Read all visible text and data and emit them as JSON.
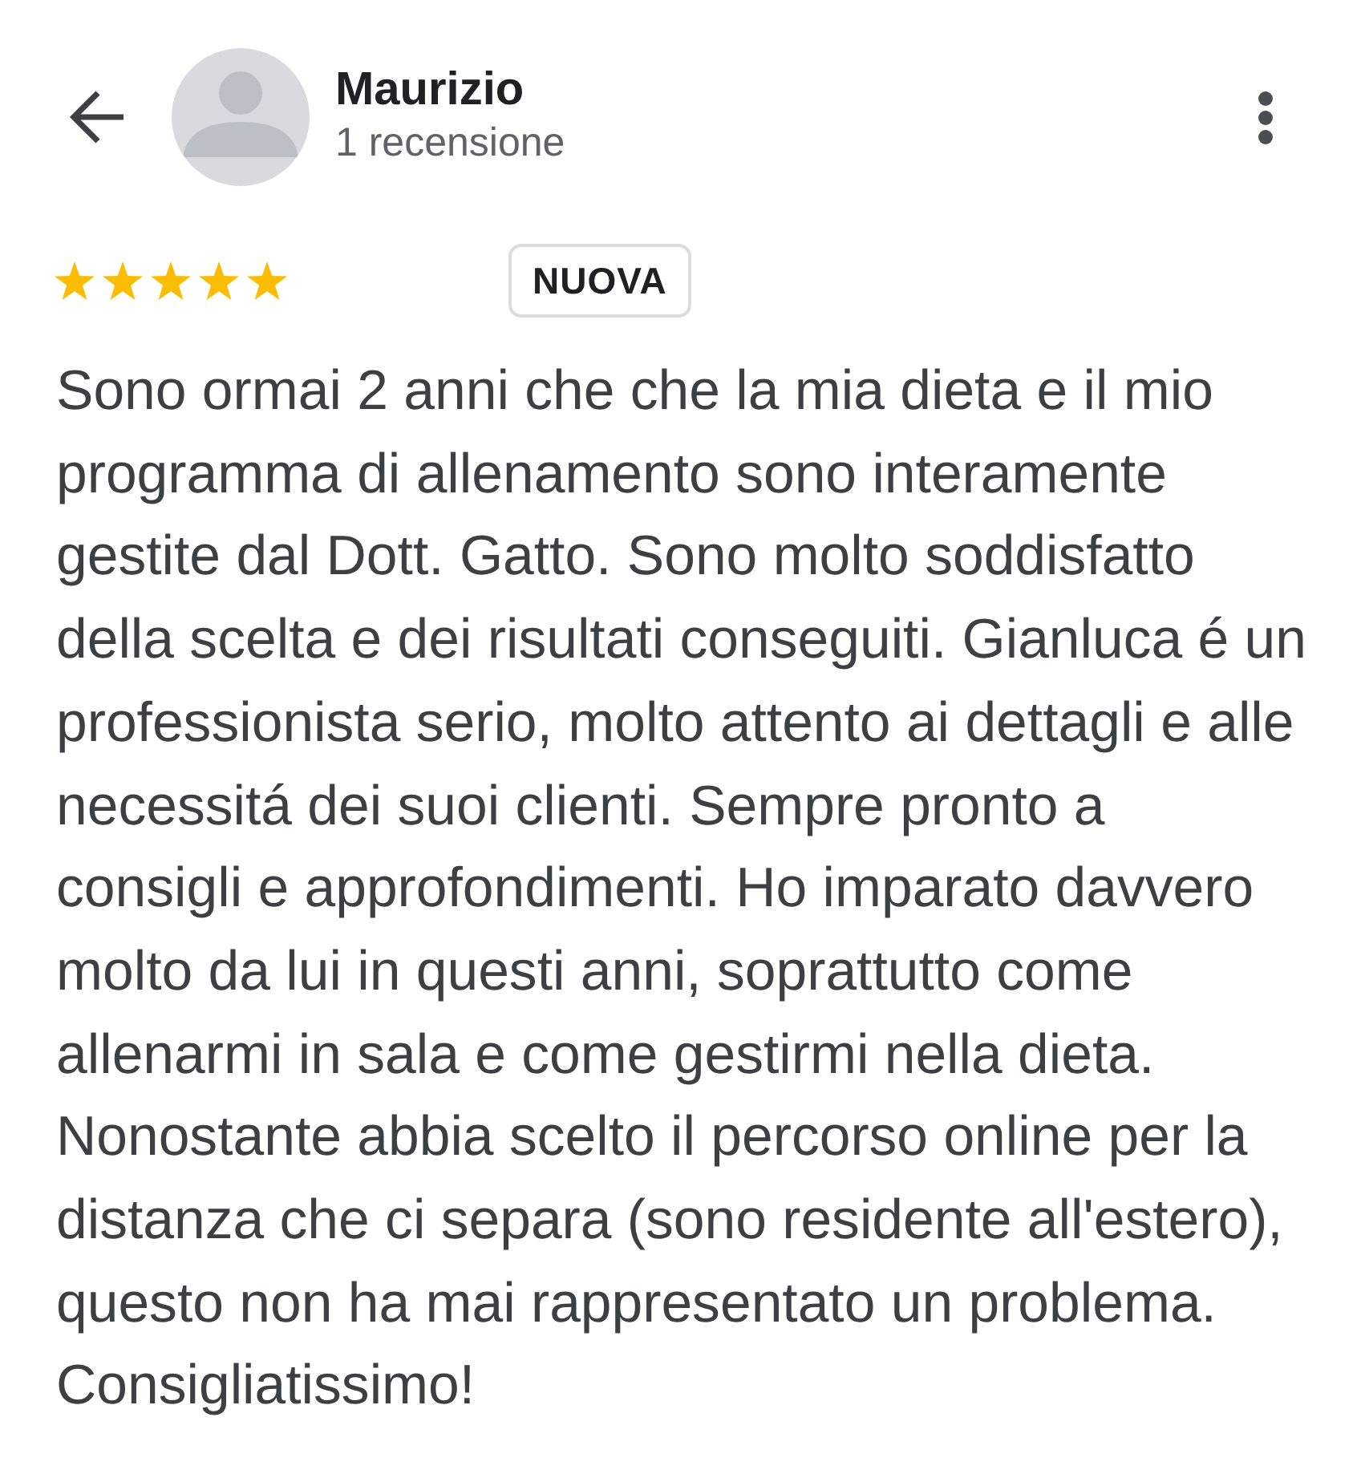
{
  "header": {
    "reviewer_name": "Maurizio",
    "review_count": "1 recensione"
  },
  "review": {
    "stars": 5,
    "badge": "NUOVA",
    "text_lines": [
      "Sono ormai 2 anni che che la mia dieta e il mio",
      "programma di allenamento sono interamente",
      "gestite dal Dott. Gatto. Sono molto soddisfatto",
      "della scelta e dei risultati conseguiti. Gianluca é un",
      "professionista serio, molto attento ai dettagli e alle",
      "necessitá dei suoi clienti. Sempre pronto a",
      "consigli e approfondimenti. Ho imparato davvero",
      "molto da lui in questi anni, soprattutto come",
      "allenarmi in sala e come gestirmi nella dieta.",
      "Nonostante abbia scelto il percorso online per la",
      "distanza che ci separa (sono residente all'estero),",
      "questo non ha mai rappresentato un problema.",
      "Consigliatissimo!"
    ]
  }
}
